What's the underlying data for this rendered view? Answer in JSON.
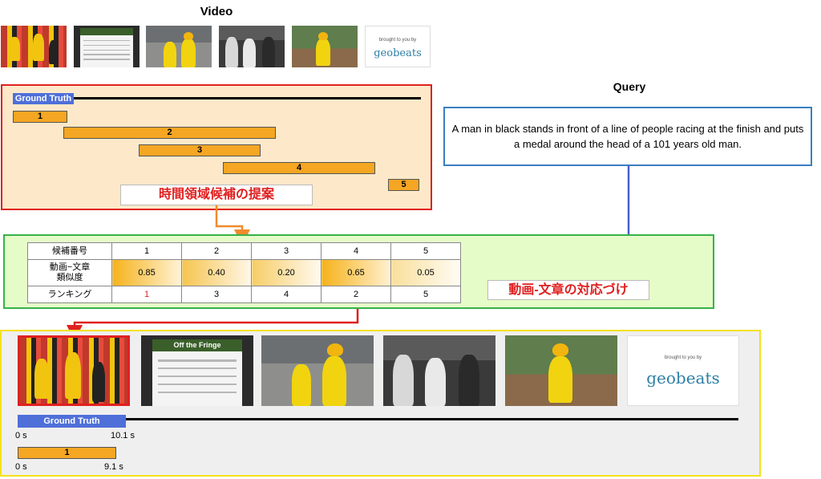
{
  "video": {
    "title": "Video",
    "logo_small": "brought to you by",
    "logo_text": "geobeats",
    "web_banner": "Off the Fringe"
  },
  "proposals": {
    "ground_truth_label": "Ground Truth",
    "items": [
      "1",
      "2",
      "3",
      "4",
      "5"
    ],
    "caption": "時間領域候補の提案"
  },
  "query": {
    "title": "Query",
    "text": "A man in black stands in front of a line of people racing at the finish and puts a medal around the head of a 101 years old man."
  },
  "matching": {
    "caption": "動画-文章の対応づけ",
    "table": {
      "header_label": "候補番号",
      "candidates": [
        "1",
        "2",
        "3",
        "4",
        "5"
      ],
      "similarity_label": "動画−文章類似度",
      "similarity": [
        "0.85",
        "0.40",
        "0.20",
        "0.65",
        "0.05"
      ],
      "ranking_label": "ランキング",
      "ranking": [
        "1",
        "3",
        "4",
        "2",
        "5"
      ]
    }
  },
  "result": {
    "ground_truth_label": "Ground Truth",
    "gt_start": "0 s",
    "gt_end": "10.1 s",
    "pred_label": "1",
    "pred_start": "0 s",
    "pred_end": "9.1 s"
  },
  "colors": {
    "ground_truth": "#4f6fd9",
    "proposal": "#f5a623",
    "proposal_box_border": "#e02020",
    "query_border": "#3a7fc0",
    "match_border": "#36b34a",
    "result_border": "#f4e21a",
    "arrow_orange": "#f08a2c",
    "arrow_blue": "#4a5ec9",
    "arrow_red": "#e02020"
  }
}
